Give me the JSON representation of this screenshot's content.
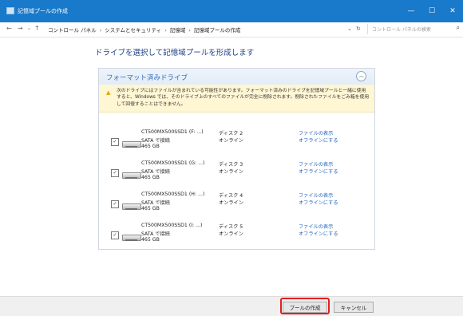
{
  "window": {
    "title": "記憶域プールの作成",
    "controls": {
      "minimize": "—",
      "maximize": "☐",
      "close": "✕"
    }
  },
  "address_bar": {
    "back": "←",
    "forward": "→",
    "recent": "⌄",
    "up": "↑",
    "breadcrumbs": [
      "コントロール パネル",
      "システムとセキュリティ",
      "記憶域",
      "記憶域プールの作成"
    ],
    "separator": "›",
    "dropdown": "⌄",
    "refresh": "↻",
    "search_placeholder": "コントロール パネルの検索",
    "search_icon": "⌕"
  },
  "heading": "ドライブを選択して記憶域プールを形成します",
  "panel": {
    "title": "フォーマット済みドライブ",
    "collapse_glyph": "︿",
    "warning_icon": "▲",
    "warning": "次のドライブにはファイルが含まれている可能性があります。フォーマット済みのドライブを記憶域プールと一緒に使用すると、Windows では、そのドライブ上のすべてのファイルが完全に削除されます。削除されたファイルをごみ箱を使用して回復することはできません。"
  },
  "drives": [
    {
      "name": "CT500MX500SSD1 (F: ...)",
      "connection": "SATA で接続",
      "size": "465 GB",
      "disk": "ディスク 2",
      "state": "オンライン",
      "link_view": "ファイルの表示",
      "link_offline": "オフラインにする",
      "checked": true
    },
    {
      "name": "CT500MX500SSD1 (G: ...)",
      "connection": "SATA で接続",
      "size": "465 GB",
      "disk": "ディスク 3",
      "state": "オンライン",
      "link_view": "ファイルの表示",
      "link_offline": "オフラインにする",
      "checked": true
    },
    {
      "name": "CT500MX500SSD1 (H: ...)",
      "connection": "SATA で接続",
      "size": "465 GB",
      "disk": "ディスク 4",
      "state": "オンライン",
      "link_view": "ファイルの表示",
      "link_offline": "オフラインにする",
      "checked": true
    },
    {
      "name": "CT500MX500SSD1 (I: ...)",
      "connection": "SATA で接続",
      "size": "465 GB",
      "disk": "ディスク 5",
      "state": "オンライン",
      "link_view": "ファイルの表示",
      "link_offline": "オフラインにする",
      "checked": true
    }
  ],
  "checkmark": "✓",
  "buttons": {
    "create": "プールの作成",
    "cancel": "キャンセル"
  },
  "colors": {
    "titlebar": "#1979ca",
    "heading": "#1e3f8a",
    "link": "#2266bb",
    "highlight": "#e21f1f",
    "warning_bg": "#fff6d4"
  }
}
